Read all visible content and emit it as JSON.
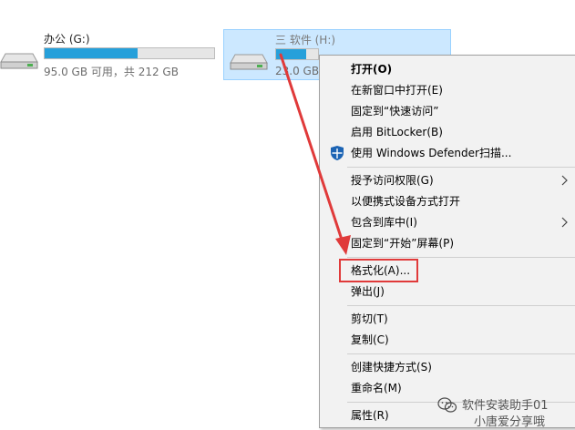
{
  "drives": [
    {
      "name": "办公 (G:)",
      "free_text": "95.0 GB 可用，共 212 GB",
      "usage_fraction": 0.55,
      "selected": false
    },
    {
      "name": "三 软件 (H:)",
      "free_text": "23.0 GB",
      "usage_fraction": 0.72,
      "selected": true
    }
  ],
  "context_menu": {
    "items": {
      "open": "打开(O)",
      "open_new_window": "在新窗口中打开(E)",
      "pin_quick_access": "固定到“快速访问”",
      "enable_bitlocker": "启用 BitLocker(B)",
      "defender_scan": "使用 Windows Defender扫描...",
      "give_access": "授予访问权限(G)",
      "open_portable": "以便携式设备方式打开",
      "include_library": "包含到库中(I)",
      "pin_start": "固定到“开始”屏幕(P)",
      "format": "格式化(A)...",
      "eject": "弹出(J)",
      "cut": "剪切(T)",
      "copy": "复制(C)",
      "create_shortcut": "创建快捷方式(S)",
      "rename": "重命名(M)",
      "properties": "属性(R)"
    }
  },
  "watermark": {
    "line1": "软件安装助手01",
    "line2": "小唐爱分享哦"
  },
  "colors": {
    "bar_fill": "#26a0da",
    "selection_bg": "#cce8ff",
    "annotation_red": "#e03a3a",
    "shield_blue": "#1c64b4"
  }
}
